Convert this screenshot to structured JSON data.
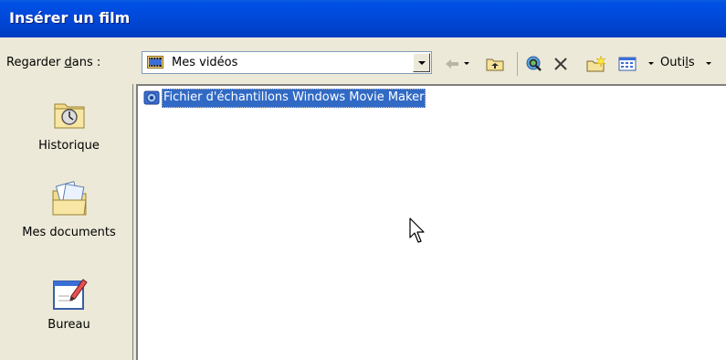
{
  "window": {
    "title": "Insérer un film"
  },
  "toolbar": {
    "look_in_prefix": "Regarder ",
    "look_in_underlined": "d",
    "look_in_suffix": "ans :",
    "location_value": "Mes vidéos",
    "location_icon": "videos-folder-icon",
    "tools_label_prefix": "Outi",
    "tools_label_underlined": "l",
    "tools_label_suffix": "s",
    "buttons": [
      "back-icon",
      "up-folder-icon",
      "search-web-icon",
      "delete-icon",
      "new-folder-icon",
      "views-menu-icon"
    ]
  },
  "places": [
    {
      "label": "Historique",
      "icon": "history-icon"
    },
    {
      "label": "Mes documents",
      "icon": "my-documents-icon"
    },
    {
      "label": "Bureau",
      "icon": "desktop-icon"
    }
  ],
  "files": [
    {
      "name": "Fichier d'échantillons Windows Movie Maker",
      "icon": "movie-maker-file-icon",
      "selected": true
    }
  ],
  "colors": {
    "titlebar": "#0047d6",
    "selection": "#316ac5",
    "dialog_bg": "#ece9d8"
  }
}
